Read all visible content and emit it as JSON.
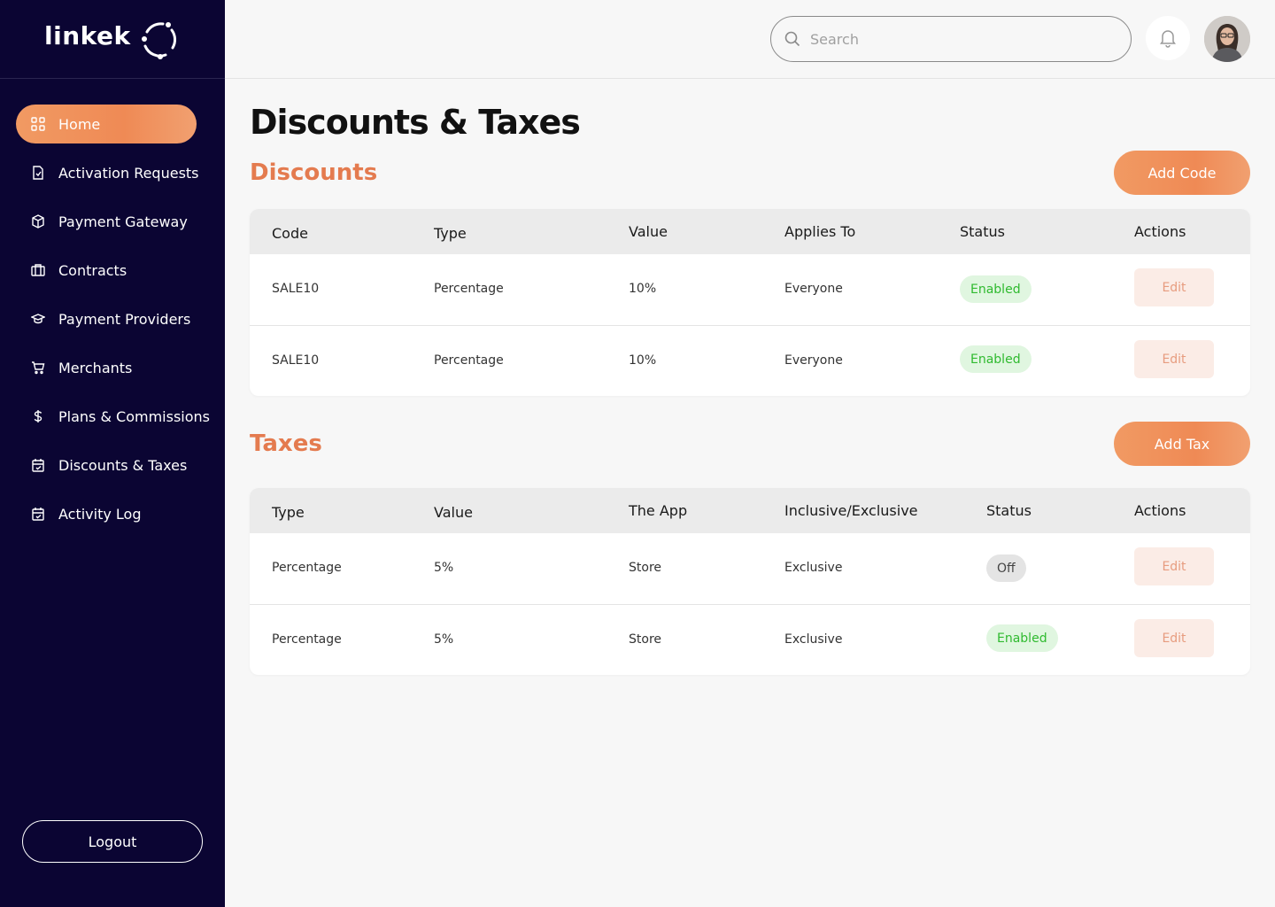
{
  "brand": {
    "name": "linkek"
  },
  "sidebar": {
    "items": [
      {
        "label": "Home",
        "icon": "grid-icon"
      },
      {
        "label": "Activation Requests",
        "icon": "document-icon"
      },
      {
        "label": "Payment Gateway",
        "icon": "box-icon"
      },
      {
        "label": "Contracts",
        "icon": "briefcase-icon"
      },
      {
        "label": "Payment Providers",
        "icon": "graduation-cap-icon"
      },
      {
        "label": "Merchants",
        "icon": "cart-icon"
      },
      {
        "label": "Plans & Commissions",
        "icon": "dollar-icon"
      },
      {
        "label": "Discounts & Taxes",
        "icon": "calendar-icon"
      },
      {
        "label": "Activity Log",
        "icon": "calendar-check-icon"
      }
    ],
    "logout_label": "Logout"
  },
  "header": {
    "search_placeholder": "Search"
  },
  "page": {
    "title": "Discounts & Taxes"
  },
  "discounts": {
    "title": "Discounts",
    "add_label": "Add Code",
    "columns": [
      "Code",
      "Type",
      "Value",
      "Applies To",
      "Status",
      "Actions"
    ],
    "rows": [
      {
        "code": "SALE10",
        "type": "Percentage",
        "value": "10%",
        "applies_to": "Everyone",
        "status": "Enabled",
        "action": "Edit"
      },
      {
        "code": "SALE10",
        "type": "Percentage",
        "value": "10%",
        "applies_to": "Everyone",
        "status": "Enabled",
        "action": "Edit"
      }
    ]
  },
  "taxes": {
    "title": "Taxes",
    "add_label": "Add Tax",
    "columns": [
      "Type",
      "Value",
      "The App",
      "Inclusive/Exclusive",
      "Status",
      "Actions"
    ],
    "rows": [
      {
        "type": "Percentage",
        "value": "5%",
        "app": "Store",
        "inclusive": "Exclusive",
        "status": "Off",
        "action": "Edit"
      },
      {
        "type": "Percentage",
        "value": "5%",
        "app": "Store",
        "inclusive": "Exclusive",
        "status": "Enabled",
        "action": "Edit"
      }
    ]
  },
  "colors": {
    "sidebar_bg": "#0b0533",
    "accent": "#ef8a55",
    "section_title": "#e47b4f",
    "enabled_bg": "#e0f6e0",
    "enabled_text": "#2fba2f"
  }
}
